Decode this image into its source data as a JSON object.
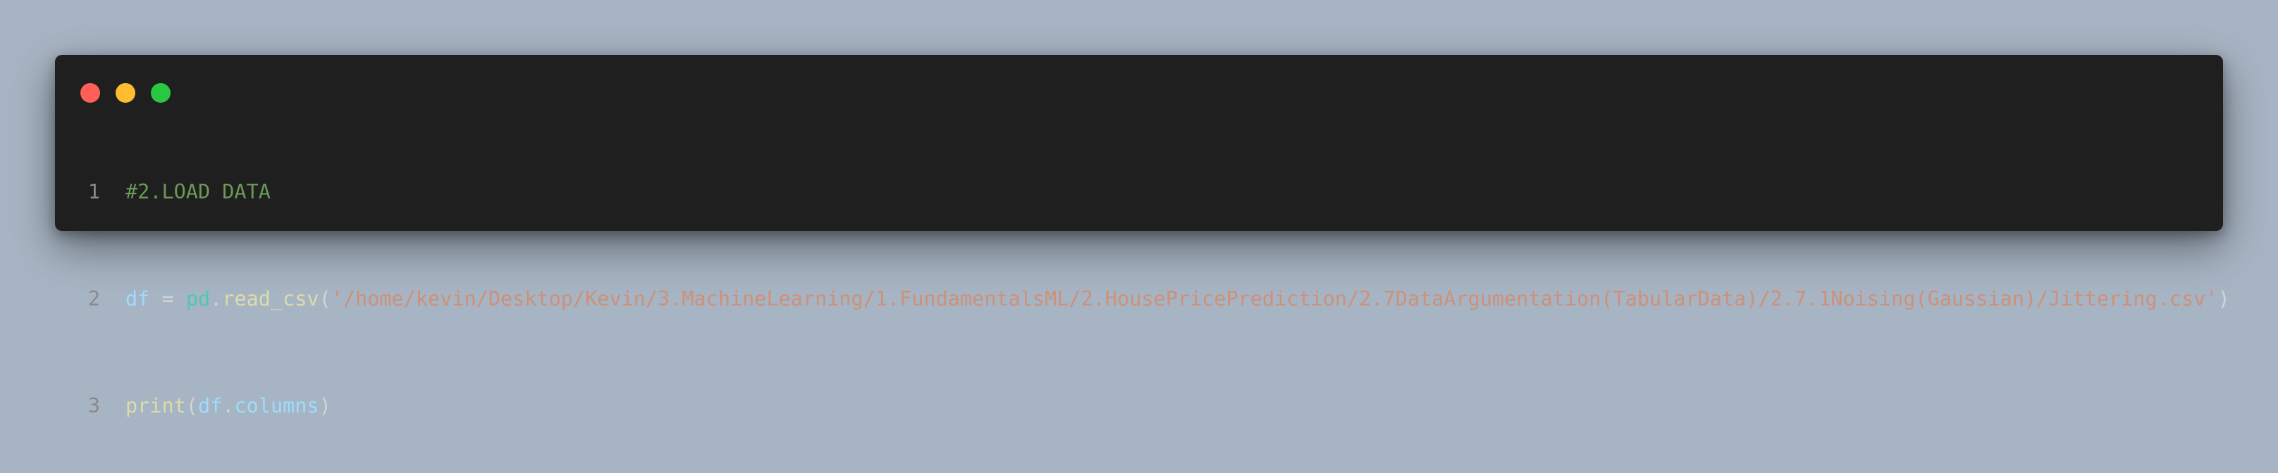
{
  "window": {
    "controls": {
      "close": "close-control",
      "minimize": "minimize-control",
      "maximize": "maximize-control"
    }
  },
  "code": {
    "lines": [
      {
        "number": "1",
        "comment": "#2.LOAD DATA"
      },
      {
        "number": "2",
        "var": "df",
        "op": " = ",
        "module": "pd",
        "dot": ".",
        "function": "read_csv",
        "open": "(",
        "string": "'/home/kevin/Desktop/Kevin/3.MachineLearning/1.FundamentalsML/2.HousePricePrediction/2.7DataArgumentation(TabularData)/2.7.1Noising(Gaussian)/Jittering.csv'",
        "close": ")"
      },
      {
        "number": "3",
        "function": "print",
        "open": "(",
        "var": "df",
        "dot": ".",
        "attr": "columns",
        "close": ")"
      }
    ]
  },
  "colors": {
    "background": "#a7b4c3",
    "editor": "#1f1f1f",
    "close": "#ff5f57",
    "minimize": "#febc2e",
    "maximize": "#28c840",
    "comment": "#6a9955",
    "variable": "#9cdcfe",
    "module": "#4ec9b0",
    "function": "#dcdcaa",
    "string": "#ce9178",
    "line_number": "#8a8a8a"
  }
}
